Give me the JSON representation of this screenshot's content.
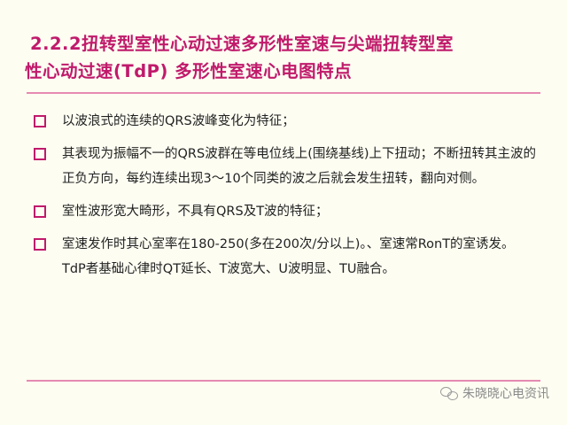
{
  "title": {
    "line1": "2.2.2扭转型室性心动过速多形性室速与尖端扭转型室",
    "line2": "性心动过速(TdP) 多形性室速心电图特点"
  },
  "items": [
    {
      "text": "以波浪式的连续的QRS波峰变化为特征；"
    },
    {
      "text": "其表现为振幅不一的QRS波群在等电位线上(围绕基线)上下扭动；不断扭转其主波的正负方向，每约连续出现3～10个同类的波之后就会发生扭转，翻向对侧。"
    },
    {
      "text": "室性波形宽大畸形，不具有QRS及T波的特征；"
    },
    {
      "text": "室速发作时其心室率在180-250(多在200次/分以上)。、室速常RonT的室诱发。TdP者基础心律时QT延长、T波宽大、U波明显、TU融合。"
    }
  ],
  "watermark": {
    "icon": "wechat-icon",
    "text": "朱晓晓心电资讯"
  },
  "colors": {
    "title": "#c01a6b",
    "rule": "#e58ab1",
    "bullet": "#c01a6b",
    "background": "#fdfdf2"
  }
}
